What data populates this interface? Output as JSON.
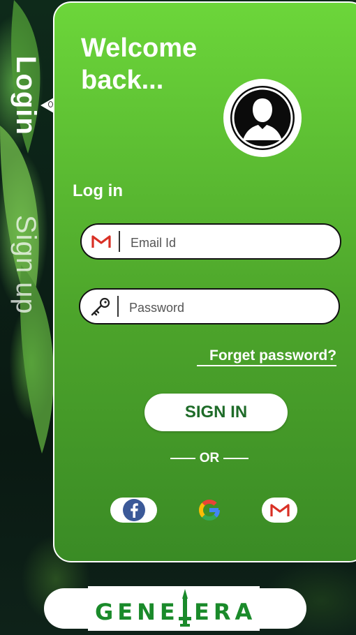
{
  "tabs": {
    "login_label": "Login",
    "signup_label": "Sign up"
  },
  "card": {
    "welcome": "Welcome back...",
    "section_title": "Log in"
  },
  "form": {
    "email_placeholder": "Email Id",
    "email_value": "",
    "email_icon": "gmail-icon",
    "password_placeholder": "Password",
    "password_value": "",
    "password_icon": "key-icon",
    "forgot_label": "Forget password?",
    "signin_label": "SIGN IN",
    "or_label": "OR"
  },
  "social": [
    {
      "name": "facebook-icon"
    },
    {
      "name": "google-icon"
    },
    {
      "name": "gmail-icon"
    }
  ],
  "brand": {
    "logo_text": "GENELERA"
  },
  "colors": {
    "card_top": "#6cd63a",
    "card_bottom": "#3a8b25",
    "signin_text": "#1e6b28"
  }
}
